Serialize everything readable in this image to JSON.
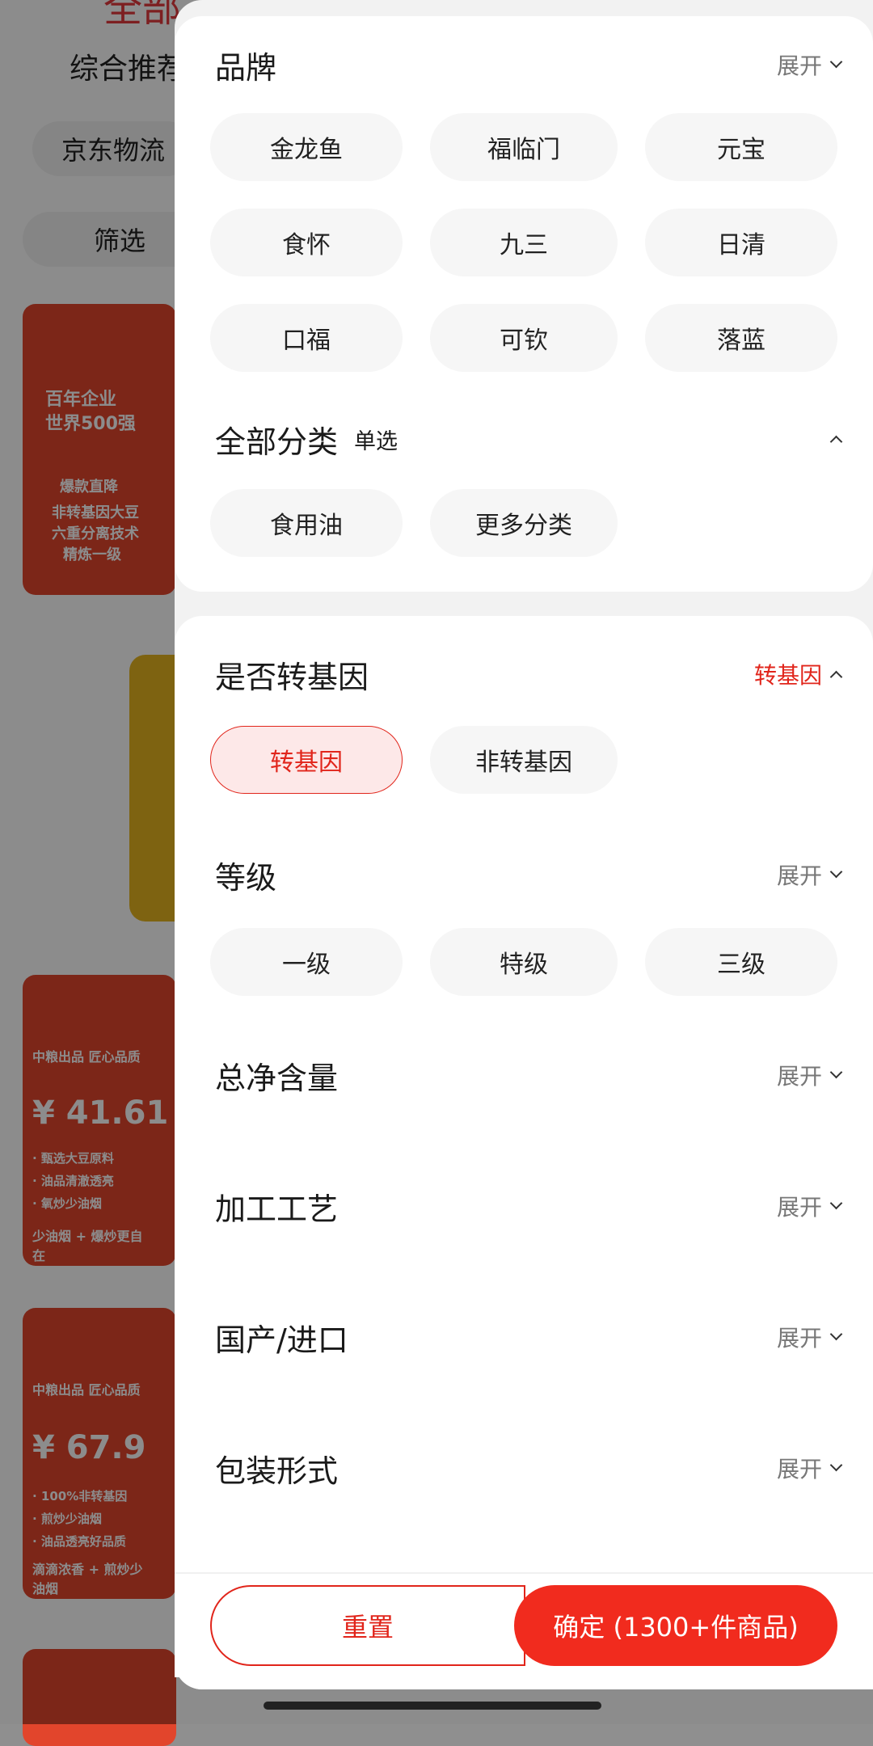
{
  "background": {
    "title": "全部",
    "sort_label": "综合推荐",
    "chip_logistics": "京东物流",
    "chip_filter": "筛选",
    "card1": {
      "line1": "百年企业",
      "line2": "世界500强",
      "tag": "爆款直降",
      "line3": "非转基因大豆",
      "line4": "六重分离技术",
      "line5": "精炼一级"
    },
    "card2": {
      "tag": "中粮出品 匠心品质",
      "price": "¥ 41.61",
      "f1": "· 甄选大豆原料",
      "f2": "· 油品清澈透亮",
      "f3": "· 氧炒少油烟",
      "slogan": "少油烟 + 爆炒更自在"
    },
    "card3": {
      "tag": "中粮出品 匠心品质",
      "price": "¥ 67.9",
      "f1": "· 100%非转基因",
      "f2": "· 煎炒少油烟",
      "f3": "· 油品透亮好品质",
      "slogan": "滴滴浓香 + 煎炒少油烟"
    }
  },
  "brand": {
    "title": "品牌",
    "toggle": "展开",
    "options": [
      "金龙鱼",
      "福临门",
      "元宝",
      "食怀",
      "九三",
      "日清",
      "口福",
      "可钦",
      "落蓝"
    ]
  },
  "category": {
    "title": "全部分类",
    "mode": "单选",
    "options": [
      "食用油",
      "更多分类"
    ]
  },
  "gmo": {
    "title": "是否转基因",
    "selected_summary": "转基因",
    "options": [
      "转基因",
      "非转基因"
    ]
  },
  "grade": {
    "title": "等级",
    "toggle": "展开",
    "options": [
      "一级",
      "特级",
      "三级"
    ]
  },
  "net_content": {
    "title": "总净含量",
    "toggle": "展开"
  },
  "process": {
    "title": "加工工艺",
    "toggle": "展开"
  },
  "origin": {
    "title": "国产/进口",
    "toggle": "展开"
  },
  "packaging": {
    "title": "包装形式",
    "toggle": "展开"
  },
  "footer": {
    "reset_label": "重置",
    "confirm_label": "确定 (1300+件商品)"
  },
  "colors": {
    "accent": "#e1251b",
    "confirm_bg": "#f12b1e",
    "chip_bg": "#f6f6f6",
    "selected_bg": "#fde8e8"
  }
}
